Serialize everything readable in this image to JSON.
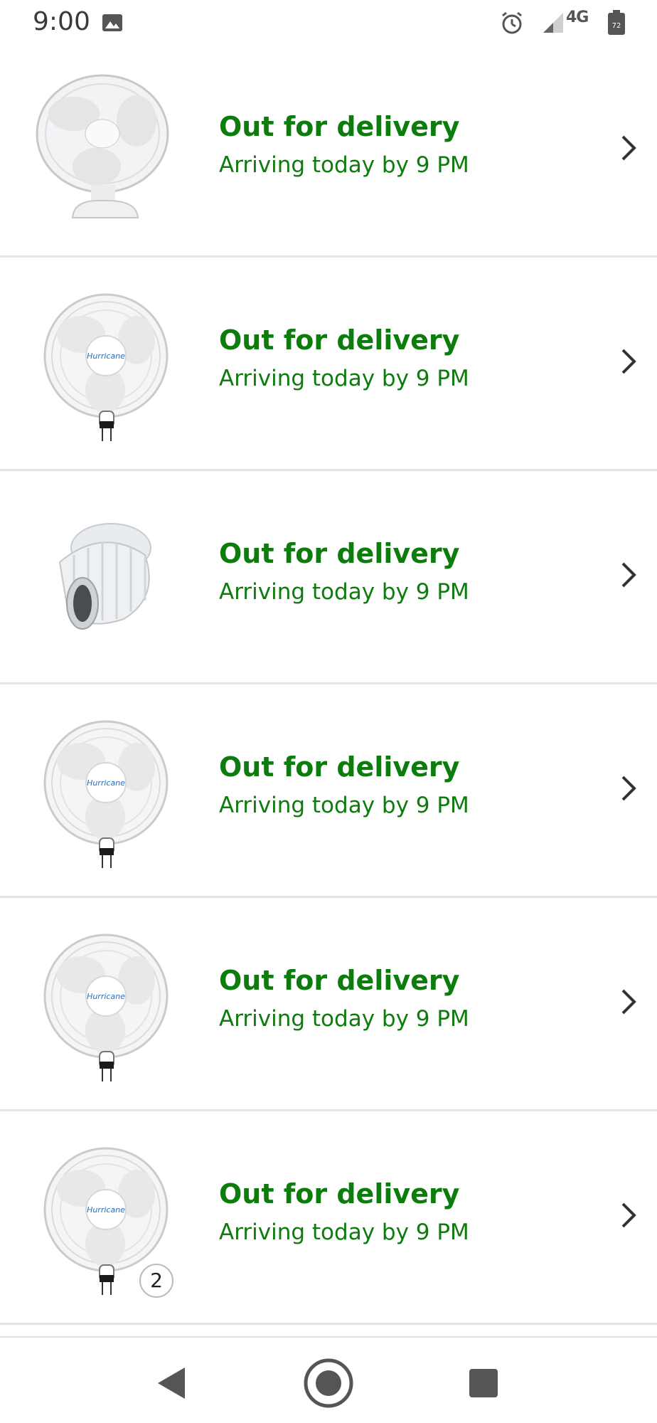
{
  "status_bar": {
    "time": "9:00",
    "network": "4G",
    "battery": "72",
    "icons": [
      "gallery-icon",
      "alarm-icon",
      "signal-icon",
      "battery-icon"
    ]
  },
  "colors": {
    "delivery_green": "#0c7c0c",
    "divider": "#e4e4e4"
  },
  "orders": [
    {
      "status": "Out for delivery",
      "arrival": "Arriving today by 9 PM",
      "product": "table-fan",
      "quantity": ""
    },
    {
      "status": "Out for delivery",
      "arrival": "Arriving today by 9 PM",
      "product": "wall-fan",
      "brand": "Hurricane",
      "quantity": ""
    },
    {
      "status": "Out for delivery",
      "arrival": "Arriving today by 9 PM",
      "product": "flexible-duct",
      "quantity": ""
    },
    {
      "status": "Out for delivery",
      "arrival": "Arriving today by 9 PM",
      "product": "wall-fan",
      "brand": "Hurricane",
      "quantity": ""
    },
    {
      "status": "Out for delivery",
      "arrival": "Arriving today by 9 PM",
      "product": "wall-fan",
      "brand": "Hurricane",
      "quantity": ""
    },
    {
      "status": "Out for delivery",
      "arrival": "Arriving today by 9 PM",
      "product": "wall-fan",
      "brand": "Hurricane",
      "quantity": "2"
    }
  ],
  "nav_bar": {
    "buttons": [
      "back-button",
      "home-button",
      "recents-button"
    ]
  }
}
